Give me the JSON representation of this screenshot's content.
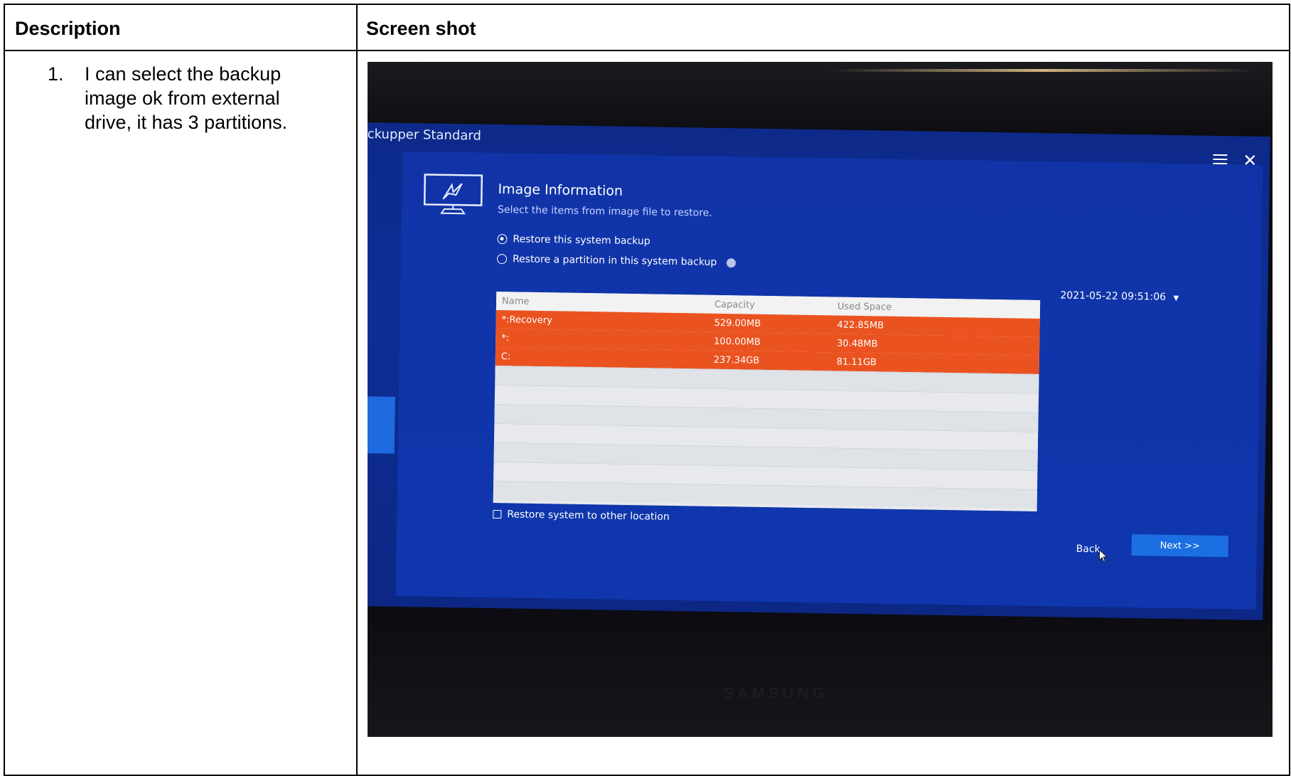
{
  "table": {
    "headers": {
      "description": "Description",
      "screenshot": "Screen shot"
    },
    "rows": [
      {
        "number": "1.",
        "description": "I can select the backup image ok from external drive, it has 3 partitions."
      }
    ]
  },
  "screenshot": {
    "app_title": "ckupper Standard",
    "header_icons": [
      "list-icon",
      "close-icon"
    ],
    "close_glyph": "✕",
    "sidebar": {
      "arrow_text": "›",
      "active_item_fragment": "e"
    },
    "panel": {
      "icon": "monitor-restore-icon",
      "title": "Image Information",
      "subtitle": "Select the items from image file to restore."
    },
    "radio_options": [
      {
        "label": "Restore this system backup",
        "checked": true
      },
      {
        "label": "Restore a partition in this system backup",
        "checked": false,
        "help_icon": "help-icon"
      }
    ],
    "date_select": {
      "value": "2021-05-22 09:51:06",
      "caret": "▼"
    },
    "partition_table": {
      "columns": [
        "Name",
        "Capacity",
        "Used Space"
      ],
      "rows": [
        {
          "name": "*:Recovery",
          "capacity": "529.00MB",
          "used": "422.85MB",
          "selected": true
        },
        {
          "name": "*:",
          "capacity": "100.00MB",
          "used": "30.48MB",
          "selected": true
        },
        {
          "name": "C:",
          "capacity": "237.34GB",
          "used": "81.11GB",
          "selected": true
        }
      ],
      "selected_color": "#ea5320"
    },
    "checkbox": {
      "label": "Restore system to other location",
      "checked": false
    },
    "buttons": {
      "back": "Back",
      "next": "Next >>"
    },
    "monitor_brand": "SAMSUNG",
    "colors": {
      "screen_background": "#0e2e96",
      "accent_button": "#1b6fe3"
    }
  }
}
